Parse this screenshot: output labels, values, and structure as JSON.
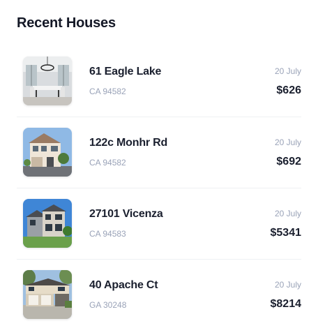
{
  "title": "Recent Houses",
  "houses": [
    {
      "address": "61 Eagle Lake",
      "zip": "CA 94582",
      "date": "20 July",
      "price": "$626",
      "image_icon": "interior-dining-room-photo"
    },
    {
      "address": "122c Monhr Rd",
      "zip": "CA 94582",
      "date": "20 July",
      "price": "$692",
      "image_icon": "house-exterior-photo"
    },
    {
      "address": "27101 Vicenza",
      "zip": "CA 94583",
      "date": "20 July",
      "price": "$5341",
      "image_icon": "house-exterior-photo"
    },
    {
      "address": "40 Apache Ct",
      "zip": "GA 30248",
      "date": "20 July",
      "price": "$8214",
      "image_icon": "house-exterior-photo"
    }
  ]
}
